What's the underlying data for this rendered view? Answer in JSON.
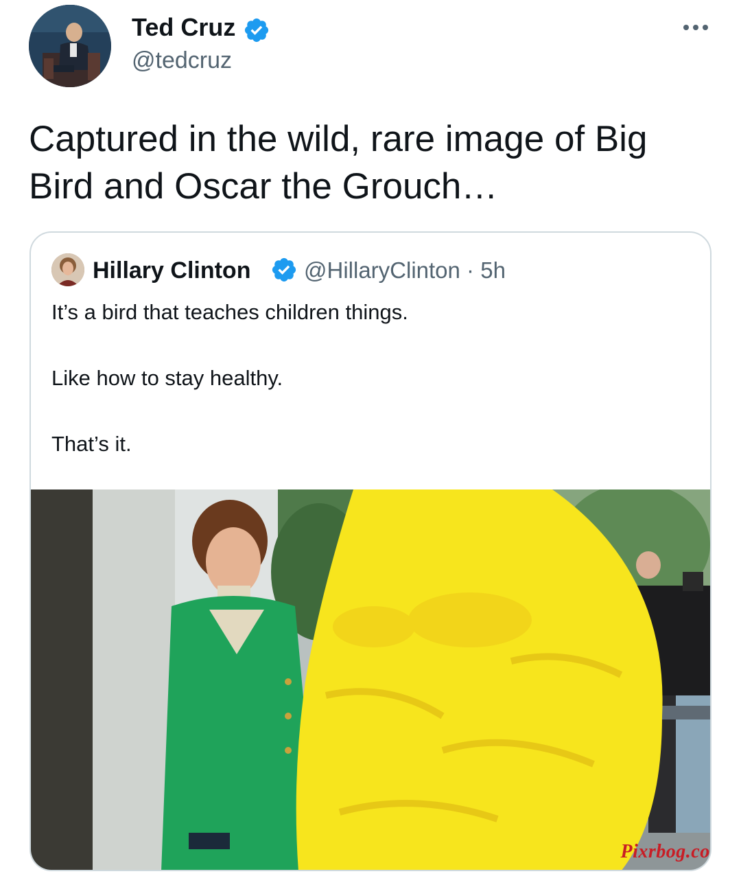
{
  "author": {
    "name": "Ted Cruz",
    "handle": "@tedcruz",
    "verified_icon": "verified-badge-icon"
  },
  "more_icon": "more-horizontal-icon",
  "tweet": {
    "text": "Captured in the wild, rare image of Big Bird and Oscar the Grouch…"
  },
  "quoted": {
    "name": "Hillary Clinton",
    "handle": "@HillaryClinton",
    "separator": "·",
    "time": "5h",
    "meta": "@HillaryClinton · 5h",
    "lines": [
      "It’s a bird that teaches children things.",
      "Like how to stay healthy.",
      "That’s it."
    ],
    "photo_watermark": "Pixrbog.com"
  },
  "colors": {
    "text_primary": "#0f1419",
    "text_secondary": "#536471",
    "verified_blue": "#1d9bf0",
    "card_border": "#cfd9de",
    "big_bird_yellow": "#f7e51d",
    "suit_green": "#1fa35a",
    "watermark_red": "#c81d25"
  }
}
